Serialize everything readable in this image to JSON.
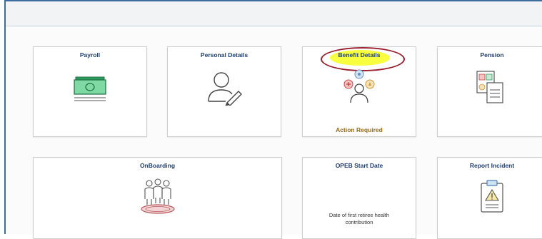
{
  "tiles": {
    "payroll": {
      "title": "Payroll",
      "icon": "money-icon"
    },
    "personal_details": {
      "title": "Personal Details",
      "icon": "person-edit-icon"
    },
    "benefit_details": {
      "title": "Benefit Details",
      "icon": "benefits-people-icon",
      "status": "Action Required"
    },
    "pension": {
      "title": "Pension",
      "icon": "pension-documents-icon"
    },
    "onboarding": {
      "title": "OnBoarding",
      "icon": "team-group-icon"
    },
    "opeb": {
      "title": "OPEB Start Date",
      "description": "Date of first retiree health contribution"
    },
    "report_incident": {
      "title": "Report Incident",
      "icon": "warning-clipboard-icon"
    }
  },
  "colors": {
    "title_blue": "#1f3e72",
    "status_amber": "#9b6a17",
    "highlight_yellow": "#f6ff2a",
    "circle_red": "#9a1f2f",
    "frame_blue": "#3d6d9e"
  }
}
